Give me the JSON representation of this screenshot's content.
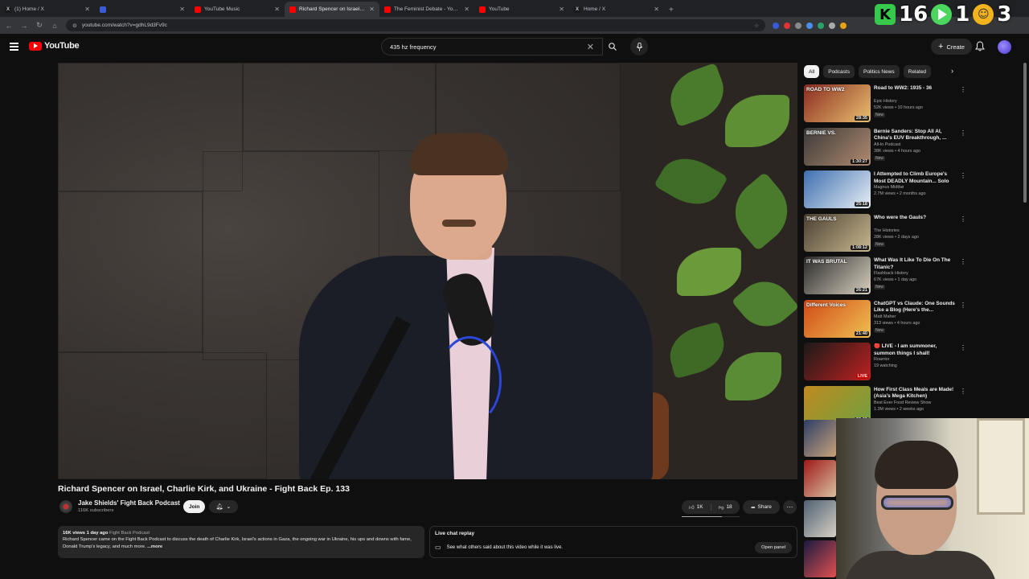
{
  "browser": {
    "tabs": [
      {
        "label": "(1) Home / X",
        "fav": "X",
        "fav_color": "#1a1a1a",
        "active": false
      },
      {
        "label": "",
        "fav": "",
        "fav_color": "#3b5bd6",
        "active": false
      },
      {
        "label": "YouTube Music",
        "fav": "",
        "fav_color": "#ff0000",
        "active": false
      },
      {
        "label": "Richard Spencer on Israel, C",
        "fav": "",
        "fav_color": "#ff0000",
        "active": true
      },
      {
        "label": "The Feminist Debate - YouTube",
        "fav": "",
        "fav_color": "#ff0000",
        "active": false
      },
      {
        "label": "YouTube",
        "fav": "",
        "fav_color": "#ff0000",
        "active": false
      },
      {
        "label": "Home / X",
        "fav": "X",
        "fav_color": "#1a1a1a",
        "active": false
      }
    ],
    "url": "youtube.com/watch?v=gdhL9d3Fv9c"
  },
  "overlay": {
    "count_a": "16",
    "count_b": "1",
    "count_c": "3",
    "k_label": "K"
  },
  "youtube": {
    "logo_text": "YouTube",
    "search_value": "435 hz frequency",
    "create_label": "Create"
  },
  "video": {
    "title": "Richard Spencer on Israel, Charlie Kirk, and Ukraine - Fight Back Ep. 133",
    "channel_name": "Jake Shields' Fight Back Podcast",
    "subscribers": "116K subscribers",
    "join_label": "Join",
    "likes": "1K",
    "dislikes": "18",
    "share_label": "Share",
    "views_age": "16K views  1 day ago",
    "tag": "Fight Back Podcast",
    "description": "Richard Spencer came on the Fight Back Podcast to discuss the death of Charlie Kirk, Israel's actions in Gaza, the ongoing war in Ukraine, his ups and downs with fame, Donald Trump's legacy, and much more.",
    "more_label": "...more"
  },
  "chat_replay": {
    "heading": "Live chat replay",
    "text": "See what others said about this video while it was live.",
    "button": "Open panel"
  },
  "chips": [
    "All",
    "Podcasts",
    "Politics News",
    "Related"
  ],
  "recommendations": [
    {
      "title": "Road to WW2: 1935 - 36",
      "channel": "Epic History",
      "meta": "52K views • 10 hours ago",
      "badge": "New",
      "duration": "28:35",
      "thumb": [
        "#8a2b20",
        "#e8c070"
      ],
      "thumb_text": "ROAD TO WW2",
      "live": false
    },
    {
      "title": "Bernie Sanders: Stop All AI, China's EUV Breakthrough, ...",
      "channel": "All-In Podcast",
      "meta": "38K views • 4 hours ago",
      "badge": "New",
      "duration": "1:30:27",
      "thumb": [
        "#3a3a3a",
        "#b08a70"
      ],
      "thumb_text": "BERNIE VS.",
      "live": false
    },
    {
      "title": "I Attempted to Climb Europe's Most DEADLY Mountain... Solo",
      "channel": "Magnus Midtbø",
      "meta": "2.7M views • 2 months ago",
      "badge": "",
      "duration": "25:18",
      "thumb": [
        "#3e6fb0",
        "#e8eef5"
      ],
      "thumb_text": "",
      "live": false
    },
    {
      "title": "Who were the Gauls?",
      "channel": "The Histories",
      "meta": "28K views • 2 days ago",
      "badge": "New",
      "duration": "1:08:12",
      "thumb": [
        "#4a4032",
        "#c8b890"
      ],
      "thumb_text": "THE GAULS",
      "live": false
    },
    {
      "title": "What Was It Like To Die On The Titanic?",
      "channel": "Flashback History",
      "meta": "67K views • 1 day ago",
      "badge": "New",
      "duration": "26:21",
      "thumb": [
        "#2a2a2a",
        "#d8d0c0"
      ],
      "thumb_text": "IT WAS BRUTAL",
      "live": false
    },
    {
      "title": "ChatGPT vs Claude: One Sounds Like a Blog (Here's the...",
      "channel": "Matt Maher",
      "meta": "313 views • 4 hours ago",
      "badge": "New",
      "duration": "21:40",
      "thumb": [
        "#d04a1a",
        "#f0c050"
      ],
      "thumb_text": "Different Voices",
      "live": false
    },
    {
      "title": "🔴 LIVE - I am summoner, summon things I shall!",
      "channel": "Roarrior",
      "meta": "19 watching",
      "badge": "",
      "duration": "LIVE",
      "thumb": [
        "#1a1a1a",
        "#c02020"
      ],
      "thumb_text": "",
      "live": true
    },
    {
      "title": "How First Class Meals are Made! (Asia's Mega Kitchen)",
      "channel": "Best Ever Food Review Show",
      "meta": "1.3M views • 2 weeks ago",
      "badge": "",
      "duration": "22:09",
      "thumb": [
        "#c08a20",
        "#70a040"
      ],
      "thumb_text": "",
      "live": false
    }
  ]
}
